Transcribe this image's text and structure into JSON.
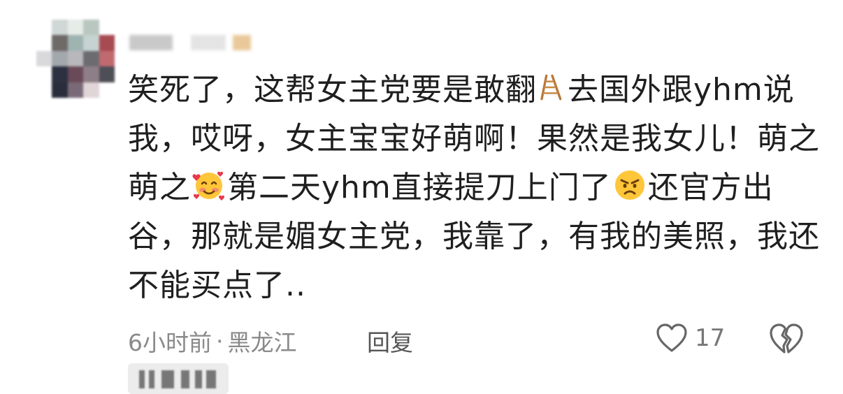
{
  "comment": {
    "lines": [
      {
        "parts": [
          "笑死了，这帮女主党要是敢翻",
          "去国外跟yhm说"
        ],
        "emoji": "ladder-icon"
      },
      {
        "parts": [
          "我，哎呀，女主宝宝好萌啊！果然是我女儿！萌之"
        ]
      },
      {
        "parts": [
          "萌之",
          "第二天yhm直接提刀上门了",
          "还官方出"
        ],
        "emojis": [
          "smiling-face-with-hearts-icon",
          "angry-face-icon"
        ]
      },
      {
        "parts": [
          "谷，那就是媚女主党，我靠了，有我的美照，我还"
        ]
      },
      {
        "parts": [
          "不能买点了.."
        ]
      }
    ]
  },
  "footer": {
    "time": "6小时前",
    "separator": "·",
    "location": "黑龙江",
    "reply_label": "回复"
  },
  "actions": {
    "like_count": "17",
    "like_icon": "heart-outline-icon",
    "dislike_icon": "broken-heart-icon"
  },
  "colors": {
    "text": "#1f1f1f",
    "meta": "#8a8a8a",
    "icon": "#666666"
  }
}
